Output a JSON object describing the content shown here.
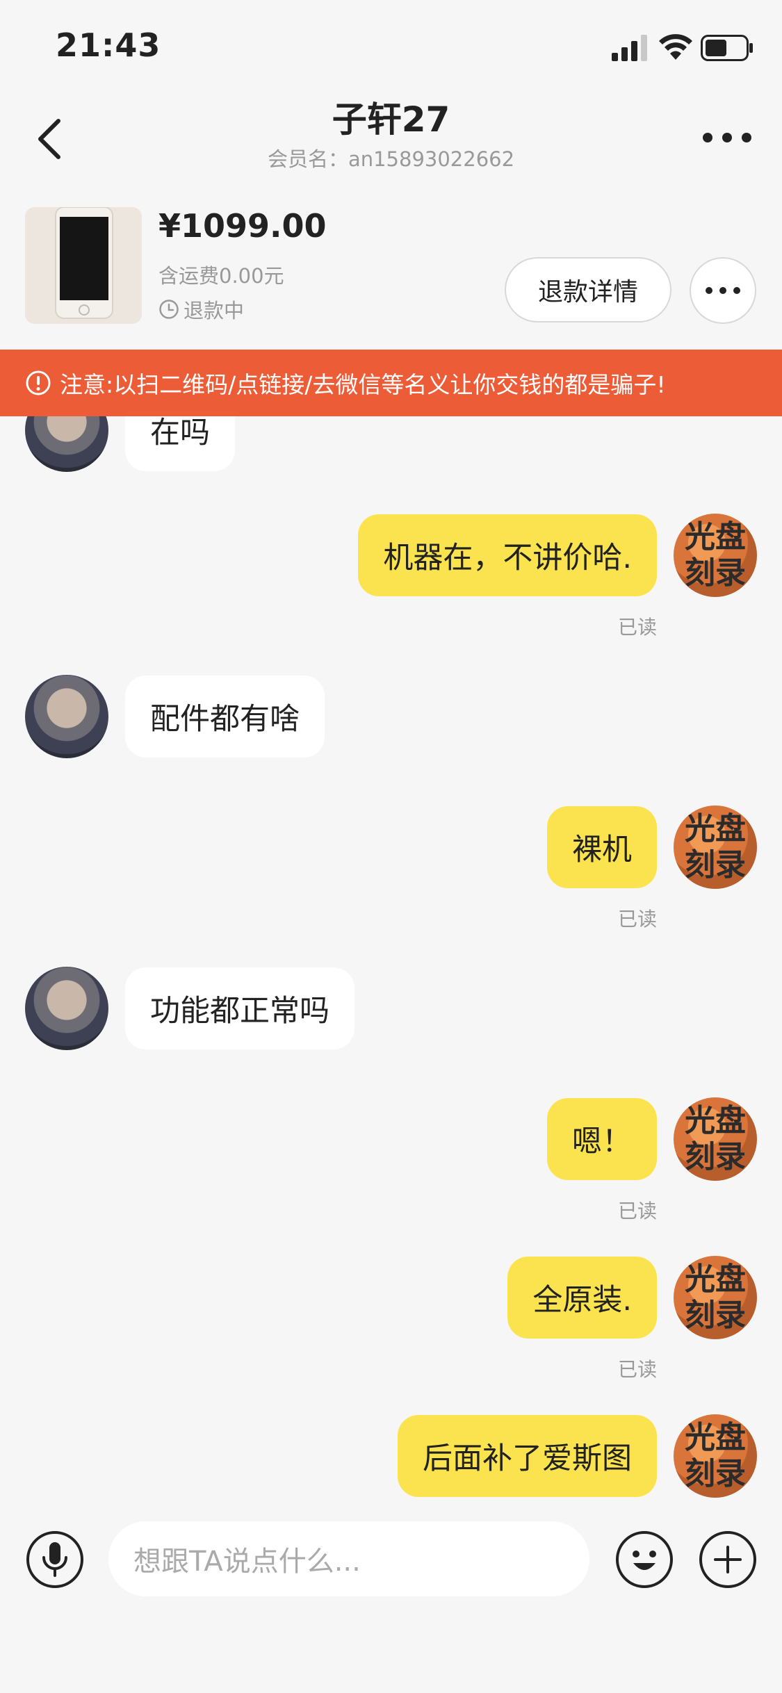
{
  "status_bar": {
    "time": "21:43"
  },
  "nav": {
    "title": "子轩27",
    "subtitle": "会员名：an15893022662"
  },
  "product": {
    "price": "¥1099.00",
    "shipping": "含运费0.00元",
    "status": "退款中",
    "refund_button_label": "退款详情"
  },
  "warning": {
    "text": "注意:以扫二维码/点链接/去微信等名义让你交钱的都是骗子!",
    "color": "#ec5c37"
  },
  "my_avatar_text": "光盘刻录",
  "messages": [
    {
      "side": "left",
      "text": "在吗"
    },
    {
      "side": "right",
      "text": "机器在，不讲价哈.",
      "read": "已读"
    },
    {
      "side": "left",
      "text": "配件都有啥"
    },
    {
      "side": "right",
      "text": "裸机",
      "read": "已读"
    },
    {
      "side": "left",
      "text": "功能都正常吗"
    },
    {
      "side": "right",
      "text": "嗯！",
      "read": "已读"
    },
    {
      "side": "right",
      "text": "全原装.",
      "read": "已读"
    },
    {
      "side": "right",
      "text": "后面补了爱斯图"
    }
  ],
  "input": {
    "placeholder": "想跟TA说点什么..."
  },
  "colors": {
    "bubble_me": "#fbe34f",
    "bubble_other": "#ffffff",
    "background": "#f6f6f6"
  }
}
